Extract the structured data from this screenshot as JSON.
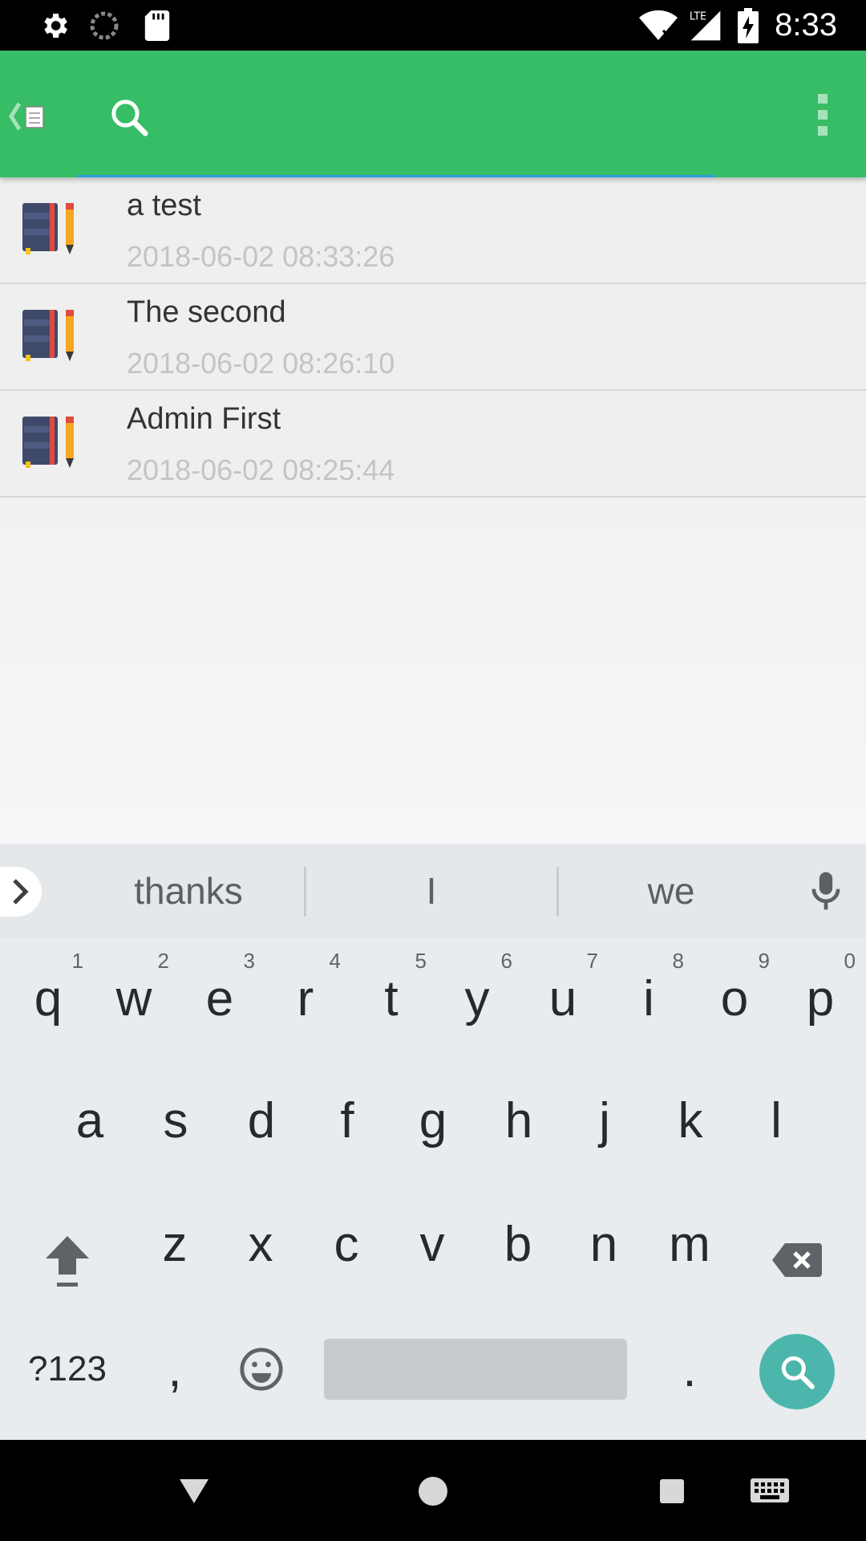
{
  "status_bar": {
    "time": "8:33",
    "icons": [
      "gear-icon",
      "sync-icon",
      "sd-card-icon",
      "wifi-icon",
      "lte-signal-icon",
      "battery-charging-icon"
    ]
  },
  "app_bar": {
    "search": {
      "value": "",
      "placeholder": ""
    },
    "icons": [
      "back-notes-icon",
      "search-icon",
      "overflow-menu-icon"
    ]
  },
  "notes": [
    {
      "title": "a test",
      "date": "2018-06-02 08:33:26"
    },
    {
      "title": "The second",
      "date": "2018-06-02 08:26:10"
    },
    {
      "title": "Admin First",
      "date": "2018-06-02 08:25:44"
    }
  ],
  "keyboard": {
    "suggestions": [
      "thanks",
      "I",
      "we"
    ],
    "row1": [
      {
        "key": "q",
        "hint": "1"
      },
      {
        "key": "w",
        "hint": "2"
      },
      {
        "key": "e",
        "hint": "3"
      },
      {
        "key": "r",
        "hint": "4"
      },
      {
        "key": "t",
        "hint": "5"
      },
      {
        "key": "y",
        "hint": "6"
      },
      {
        "key": "u",
        "hint": "7"
      },
      {
        "key": "i",
        "hint": "8"
      },
      {
        "key": "o",
        "hint": "9"
      },
      {
        "key": "p",
        "hint": "0"
      }
    ],
    "row2": [
      "a",
      "s",
      "d",
      "f",
      "g",
      "h",
      "j",
      "k",
      "l"
    ],
    "row3": [
      "z",
      "x",
      "c",
      "v",
      "b",
      "n",
      "m"
    ],
    "row4": {
      "symbols": "?123",
      "comma": ",",
      "period": "."
    },
    "accent": "#4db6ac"
  },
  "colors": {
    "app_bar": "#37bd65",
    "underline": "#2a9fd6"
  }
}
